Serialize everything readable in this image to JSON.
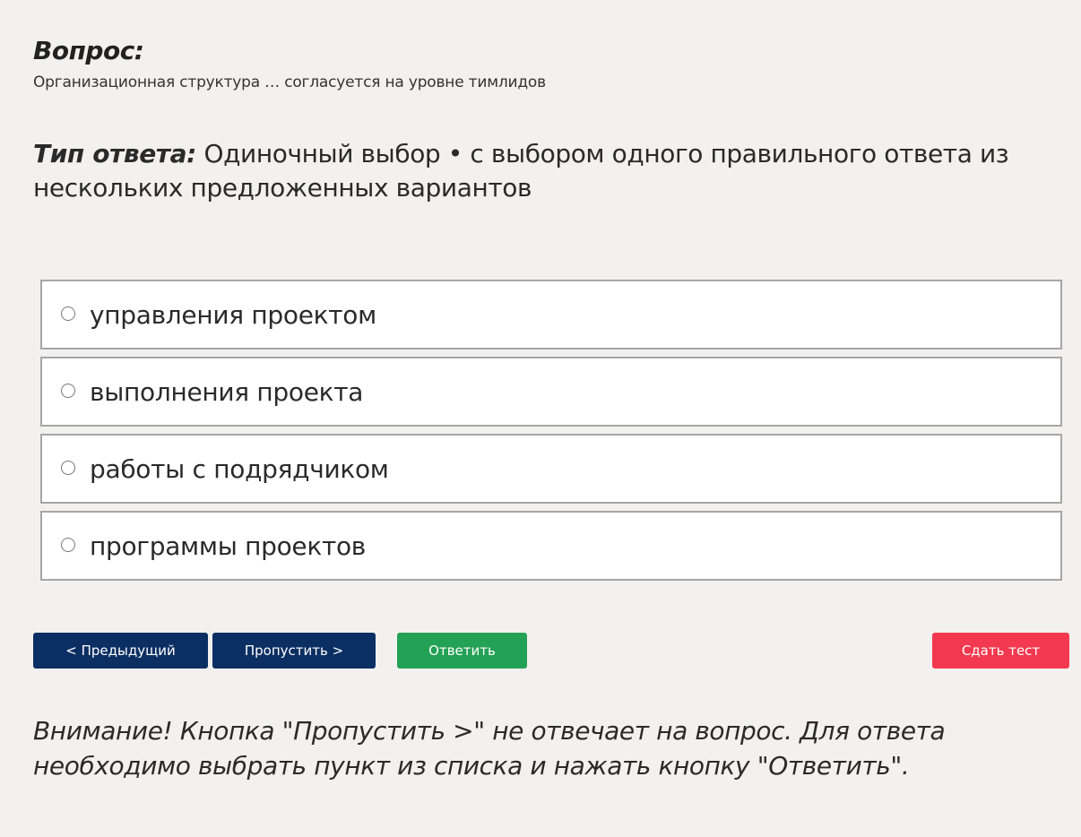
{
  "question": {
    "heading": "Вопрос:",
    "text": "Организационная структура … согласуется на уровне тимлидов"
  },
  "answer_type": {
    "label": "Тип ответа:",
    "value": "Одиночный выбор • с выбором одного правильного ответа из нескольких предложенных вариантов"
  },
  "options": [
    {
      "label": "управления проектом",
      "selected": false
    },
    {
      "label": "выполнения проекта",
      "selected": false
    },
    {
      "label": "работы с подрядчиком",
      "selected": false
    },
    {
      "label": "программы проектов",
      "selected": false
    }
  ],
  "buttons": {
    "prev": "< Предыдущий",
    "skip": "Пропустить >",
    "answer": "Ответить",
    "submit": "Сдать тест"
  },
  "colors": {
    "nav_button": "#0b2f63",
    "answer_button": "#23a154",
    "submit_button": "#f3394f"
  },
  "notice": "Внимание! Кнопка \"Пропустить >\" не отвечает на вопрос. Для ответа необходимо выбрать пункт из списка и нажать кнопку \"Ответить\"."
}
